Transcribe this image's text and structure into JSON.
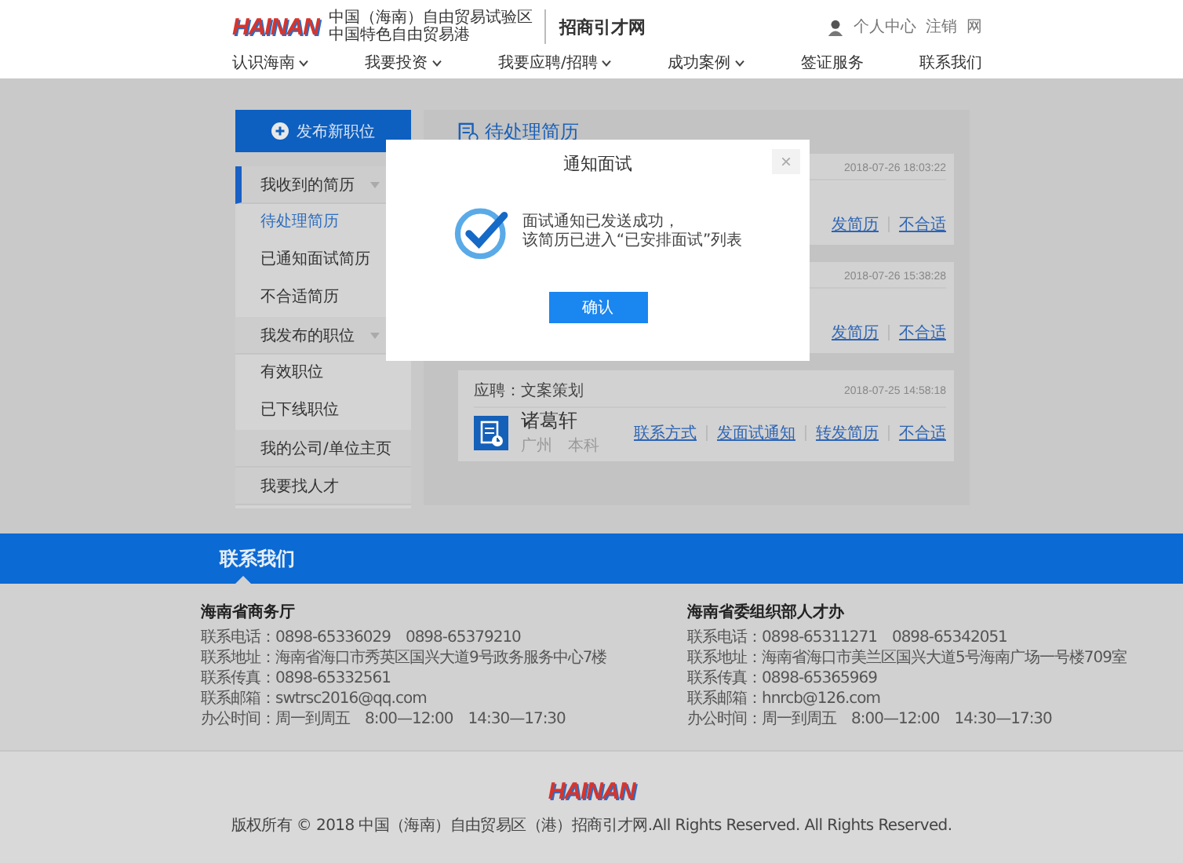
{
  "header": {
    "logo": "HAINAN",
    "subtitle_lines": [
      "中国（海南）自由贸易试验区",
      "中国特色自由贸易港"
    ],
    "site_name": "招商引才网",
    "user_links": [
      "个人中心",
      "注销",
      "网"
    ]
  },
  "nav": [
    {
      "label": "认识海南",
      "dropdown": true
    },
    {
      "label": "我要投资",
      "dropdown": true
    },
    {
      "label": "我要应聘/招聘",
      "dropdown": true
    },
    {
      "label": "成功案例",
      "dropdown": true
    },
    {
      "label": "签证服务",
      "dropdown": false
    },
    {
      "label": "联系我们",
      "dropdown": false
    }
  ],
  "sidebar": {
    "publish_button": "发布新职位",
    "items": [
      {
        "label": "我收到的简历",
        "selected": true,
        "expanded": true,
        "children": [
          {
            "label": "待处理简历",
            "selected": true
          },
          {
            "label": "已通知面试简历",
            "selected": false
          },
          {
            "label": "不合适简历",
            "selected": false
          }
        ]
      },
      {
        "label": "我发布的职位",
        "selected": false,
        "expanded": true,
        "children": [
          {
            "label": "有效职位",
            "selected": false
          },
          {
            "label": "已下线职位",
            "selected": false
          }
        ]
      },
      {
        "label": "我的公司/单位主页",
        "selected": false
      },
      {
        "label": "我要找人才",
        "selected": false
      }
    ]
  },
  "panel": {
    "title": "待处理简历",
    "cards": [
      {
        "time": "2018-07-26 18:03:22",
        "actions": [
          "发简历",
          "不合适"
        ]
      },
      {
        "time": "2018-07-26 15:38:28",
        "actions": [
          "发简历",
          "不合适"
        ]
      },
      {
        "position": "应聘：文案策划",
        "time": "2018-07-25 14:58:18",
        "name": "诸葛轩",
        "meta": "广州　本科",
        "actions": [
          "联系方式",
          "发面试通知",
          "转发简历",
          "不合适"
        ]
      }
    ]
  },
  "dialog": {
    "title": "通知面试",
    "close": "×",
    "message_lines": [
      "面试通知已发送成功，",
      "该简历已进入“已安排面试”列表"
    ],
    "confirm": "确认"
  },
  "footer": {
    "heading": "联系我们",
    "contacts": [
      {
        "org": "海南省商务厅",
        "lines": [
          "联系电话：0898-65336029　0898-65379210",
          "联系地址：海南省海口市秀英区国兴大道9号政务服务中心7楼",
          "联系传真：0898-65332561",
          "联系邮箱：swtrsc2016@qq.com",
          "办公时间：周一到周五　8:00—12:00　14:30—17:30"
        ]
      },
      {
        "org": "海南省委组织部人才办",
        "lines": [
          "联系电话：0898-65311271　0898-65342051",
          "联系地址：海南省海口市美兰区国兴大道5号海南广场一号楼709室",
          "联系传真：0898-65365969",
          "联系邮箱：hnrcb@126.com",
          "办公时间：周一到周五　8:00—12:00　14:30—17:30"
        ]
      }
    ],
    "logo": "HAINAN",
    "copyright": "版权所有 © 2018 中国（海南）自由贸易区（港）招商引才网.All Rights Reserved. All Rights Reserved."
  }
}
